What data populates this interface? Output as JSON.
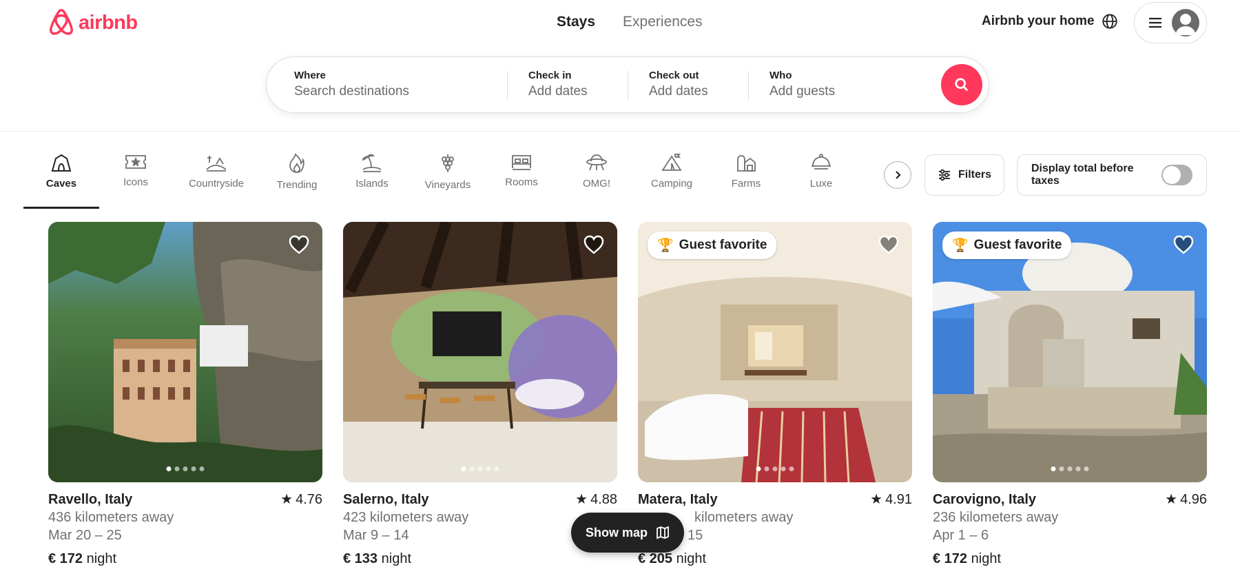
{
  "header": {
    "logo_text": "airbnb",
    "brand_color": "#ff385c",
    "tabs": [
      {
        "label": "Stays",
        "active": true
      },
      {
        "label": "Experiences",
        "active": false
      }
    ],
    "host_link": "Airbnb your home",
    "globe_icon": "globe-icon",
    "menu_icon": "hamburger-icon",
    "avatar_icon": "user-avatar-icon"
  },
  "search": {
    "where": {
      "label": "Where",
      "placeholder": "Search destinations"
    },
    "checkin": {
      "label": "Check in",
      "placeholder": "Add dates"
    },
    "checkout": {
      "label": "Check out",
      "placeholder": "Add dates"
    },
    "who": {
      "label": "Who",
      "placeholder": "Add guests"
    },
    "button_icon": "search-icon"
  },
  "categories": {
    "items": [
      {
        "label": "Caves",
        "icon": "cave-icon",
        "active": true
      },
      {
        "label": "Icons",
        "icon": "ticket-star-icon",
        "active": false
      },
      {
        "label": "Countryside",
        "icon": "countryside-icon",
        "active": false
      },
      {
        "label": "Trending",
        "icon": "flame-icon",
        "active": false
      },
      {
        "label": "Islands",
        "icon": "island-icon",
        "active": false
      },
      {
        "label": "Vineyards",
        "icon": "grapes-icon",
        "active": false
      },
      {
        "label": "Rooms",
        "icon": "bed-icon",
        "active": false
      },
      {
        "label": "OMG!",
        "icon": "ufo-house-icon",
        "active": false
      },
      {
        "label": "Camping",
        "icon": "tent-icon",
        "active": false
      },
      {
        "label": "Farms",
        "icon": "barn-icon",
        "active": false
      },
      {
        "label": "Luxe",
        "icon": "cloche-icon",
        "active": false
      }
    ],
    "next_icon": "chevron-right-icon",
    "filters_label": "Filters",
    "filters_icon": "sliders-icon",
    "tax_toggle_label": "Display total before taxes",
    "tax_toggle_on": false
  },
  "listings": [
    {
      "location": "Ravello, Italy",
      "rating": "4.76",
      "distance": "436 kilometers away",
      "dates": "Mar 20 – 25",
      "price": "€ 172",
      "price_unit": "night",
      "badge": "",
      "dots": 5
    },
    {
      "location": "Salerno, Italy",
      "rating": "4.88",
      "distance": "423 kilometers away",
      "dates": "Mar 9 – 14",
      "price": "€ 133",
      "price_unit": "night",
      "badge": "",
      "dots": 5
    },
    {
      "location": "Matera, Italy",
      "rating": "4.91",
      "distance": "kilometers away",
      "dates": "15",
      "price": "€ 205",
      "price_unit": "night",
      "badge": "Guest favorite",
      "dots": 5
    },
    {
      "location": "Carovigno, Italy",
      "rating": "4.96",
      "distance": "236 kilometers away",
      "dates": "Apr 1 – 6",
      "price": "€ 172",
      "price_unit": "night",
      "badge": "Guest favorite",
      "dots": 5
    }
  ],
  "show_map": {
    "label": "Show map",
    "icon": "map-icon"
  }
}
